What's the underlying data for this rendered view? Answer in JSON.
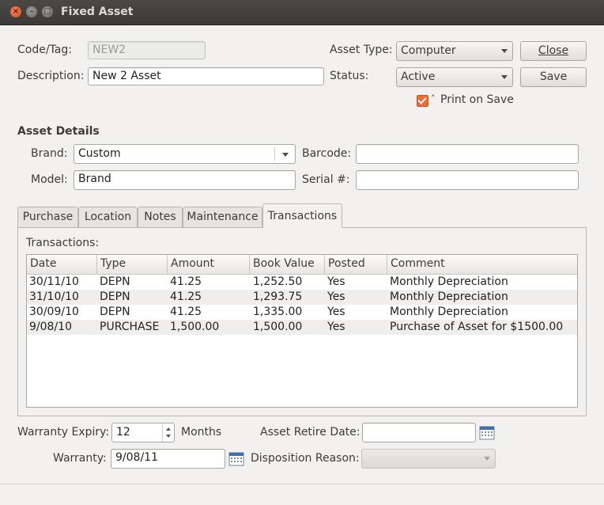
{
  "window": {
    "title": "Fixed Asset"
  },
  "form": {
    "code_label": "Code/Tag:",
    "code_value": "NEW2",
    "description_label": "Description:",
    "description_value": "New 2 Asset",
    "asset_type_label": "Asset Type:",
    "asset_type_value": "Computer",
    "status_label": "Status:",
    "status_value": "Active",
    "close_label": "Close",
    "save_label": "Save",
    "print_on_save_label": "Print on Save",
    "print_on_save_checked": true
  },
  "details": {
    "heading": "Asset Details",
    "brand_label": "Brand:",
    "brand_value": "Custom",
    "barcode_label": "Barcode:",
    "barcode_value": "",
    "model_label": "Model:",
    "model_value": "Brand",
    "serial_label": "Serial #:",
    "serial_value": ""
  },
  "tabs": [
    {
      "label": "Purchase"
    },
    {
      "label": "Location"
    },
    {
      "label": "Notes"
    },
    {
      "label": "Maintenance"
    },
    {
      "label": "Transactions",
      "active": true
    }
  ],
  "transactions": {
    "caption": "Transactions:",
    "columns": [
      "Date",
      "Type",
      "Amount",
      "Book Value",
      "Posted",
      "Comment"
    ],
    "rows": [
      [
        "30/11/10",
        "DEPN",
        "41.25",
        "1,252.50",
        "Yes",
        "Monthly Depreciation"
      ],
      [
        "31/10/10",
        "DEPN",
        "41.25",
        "1,293.75",
        "Yes",
        "Monthly Depreciation"
      ],
      [
        "30/09/10",
        "DEPN",
        "41.25",
        "1,335.00",
        "Yes",
        "Monthly Depreciation"
      ],
      [
        "9/08/10",
        "PURCHASE",
        "1,500.00",
        "1,500.00",
        "Yes",
        "Purchase of Asset for $1500.00"
      ]
    ]
  },
  "warranty": {
    "expiry_label": "Warranty Expiry:",
    "expiry_value": "12",
    "months_label": "Months",
    "warranty_label": "Warranty:",
    "warranty_value": "9/08/11",
    "retire_label": "Asset Retire Date:",
    "retire_value": "",
    "disposition_label": "Disposition Reason:",
    "disposition_value": ""
  }
}
